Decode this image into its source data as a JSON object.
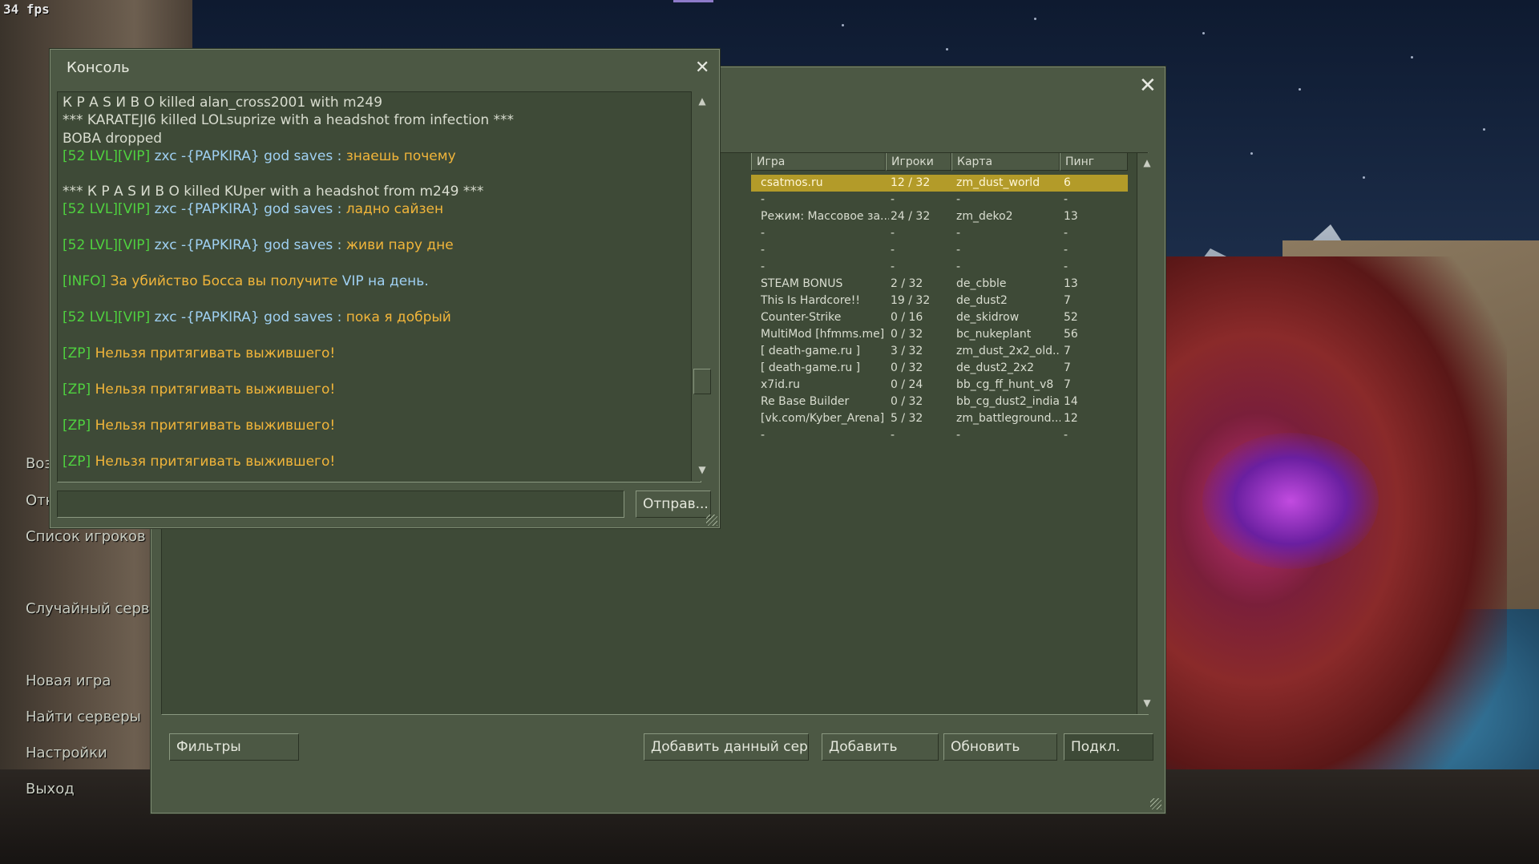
{
  "hud": {
    "fps": "34 fps"
  },
  "game_menu": {
    "items": [
      {
        "label": "Воз"
      },
      {
        "label": "Отк"
      },
      {
        "label": "Список игроков"
      },
      {
        "label": "Случайный серв"
      },
      {
        "label": "Новая игра"
      },
      {
        "label": "Найти серверы"
      },
      {
        "label": "Настройки"
      },
      {
        "label": "Выход"
      }
    ]
  },
  "server_browser": {
    "close_icon": "close-icon",
    "columns": [
      {
        "label": "Игра"
      },
      {
        "label": "Игроки"
      },
      {
        "label": "Карта"
      },
      {
        "label": "Пинг"
      }
    ],
    "rows": [
      {
        "name": "csatmos.ru",
        "players": "12 / 32",
        "map": "zm_dust_world",
        "ping": "6",
        "selected": true
      },
      {
        "name": "-",
        "players": "-",
        "map": "-",
        "ping": "-"
      },
      {
        "name": "Режим: Массовое за...",
        "players": "24 / 32",
        "map": "zm_deko2",
        "ping": "13"
      },
      {
        "name": "-",
        "players": "-",
        "map": "-",
        "ping": "-"
      },
      {
        "name": "-",
        "players": "-",
        "map": "-",
        "ping": "-"
      },
      {
        "name": "-",
        "players": "-",
        "map": "-",
        "ping": "-"
      },
      {
        "name": "STEAM BONUS",
        "players": "2 / 32",
        "map": "de_cbble",
        "ping": "13"
      },
      {
        "name": "This Is Hardcore!!",
        "players": "19 / 32",
        "map": "de_dust2",
        "ping": "7"
      },
      {
        "name": "Counter-Strike",
        "players": "0 / 16",
        "map": "de_skidrow",
        "ping": "52"
      },
      {
        "name": "MultiMod [hfmms.me]",
        "players": "0 / 32",
        "map": "bc_nukeplant",
        "ping": "56"
      },
      {
        "name": "[ death-game.ru ]",
        "players": "3 / 32",
        "map": "zm_dust_2x2_old...",
        "ping": "7"
      },
      {
        "name": "[ death-game.ru ]",
        "players": "0 / 32",
        "map": "de_dust2_2x2",
        "ping": "7"
      },
      {
        "name": "x7id.ru",
        "players": "0 / 24",
        "map": "bb_cg_ff_hunt_v8",
        "ping": "7"
      },
      {
        "name": "Re Base Builder",
        "players": "0 / 32",
        "map": "bb_cg_dust2_india",
        "ping": "14"
      },
      {
        "name": "[vk.com/Kyber_Arena]",
        "players": "5 / 32",
        "map": "zm_battleground...",
        "ping": "12"
      },
      {
        "name": "-",
        "players": "-",
        "map": "-",
        "ping": "-"
      }
    ],
    "buttons": {
      "filters": "Фильтры",
      "add_current": "Добавить данный сер...",
      "add": "Добавить",
      "refresh": "Обновить",
      "connect": "Подкл."
    }
  },
  "console": {
    "title": "Консоль",
    "close_icon": "close-icon",
    "lines": [
      {
        "segments": [
          {
            "text": "К Р А S И В О killed alan_cross2001 with m249",
            "color": "white"
          }
        ]
      },
      {
        "segments": [
          {
            "text": "*** KARATEJI6 killed LOLsuprize with a headshot from infection ***",
            "color": "white"
          }
        ]
      },
      {
        "segments": [
          {
            "text": "BOBA dropped",
            "color": "white"
          }
        ]
      },
      {
        "segments": [
          {
            "text": "[52 LVL][VIP] ",
            "color": "green"
          },
          {
            "text": "zxc -{PAPKIRA} god saves : ",
            "color": "blue"
          },
          {
            "text": "знаешь почему",
            "color": "yellow"
          }
        ]
      },
      {
        "segments": [
          {
            "text": "*** К Р А S И В О killed KUper with a headshot from m249 ***",
            "color": "white"
          }
        ]
      },
      {
        "segments": [
          {
            "text": "[52 LVL][VIP] ",
            "color": "green"
          },
          {
            "text": "zxc -{PAPKIRA} god saves : ",
            "color": "blue"
          },
          {
            "text": "ладно сайзен",
            "color": "yellow"
          }
        ]
      },
      {
        "segments": [
          {
            "text": "[52 LVL][VIP] ",
            "color": "green"
          },
          {
            "text": "zxc -{PAPKIRA} god saves : ",
            "color": "blue"
          },
          {
            "text": "живи пару дне",
            "color": "yellow"
          }
        ]
      },
      {
        "segments": [
          {
            "text": "[INFO] ",
            "color": "green"
          },
          {
            "text": "За убийство Босса вы получите ",
            "color": "yellow"
          },
          {
            "text": "VIP на день.",
            "color": "blue"
          }
        ]
      },
      {
        "segments": [
          {
            "text": "[52 LVL][VIP] ",
            "color": "green"
          },
          {
            "text": "zxc -{PAPKIRA} god saves : ",
            "color": "blue"
          },
          {
            "text": "пока я добрый",
            "color": "yellow"
          }
        ]
      },
      {
        "segments": [
          {
            "text": "[ZP] ",
            "color": "green"
          },
          {
            "text": "Нельзя притягивать выжившего!",
            "color": "yellow"
          }
        ]
      },
      {
        "segments": [
          {
            "text": "[ZP] ",
            "color": "green"
          },
          {
            "text": "Нельзя притягивать выжившего!",
            "color": "yellow"
          }
        ]
      },
      {
        "segments": [
          {
            "text": "[ZP] ",
            "color": "green"
          },
          {
            "text": "Нельзя притягивать выжившего!",
            "color": "yellow"
          }
        ]
      },
      {
        "segments": [
          {
            "text": "[ZP] ",
            "color": "green"
          },
          {
            "text": "Нельзя притягивать выжившего!",
            "color": "yellow"
          }
        ]
      }
    ],
    "input_value": "",
    "submit_label": "Отправ..."
  },
  "colors": {
    "panel": "#4c5844",
    "selected_row": "#b39b29",
    "log_green": "#4fd13f",
    "log_blue": "#9fd0f2",
    "log_yellow": "#f1b53a",
    "log_white": "#d8dccf"
  }
}
